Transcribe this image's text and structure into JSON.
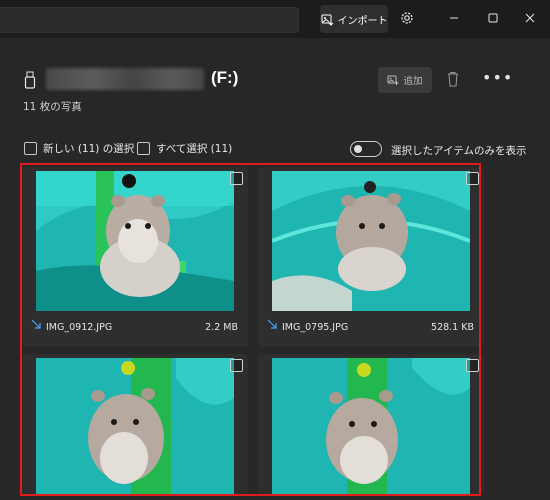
{
  "titlebar": {
    "import_label": "インポート",
    "icons": [
      "import-icon",
      "gear-icon",
      "minimize-icon",
      "maximize-icon",
      "close-icon"
    ]
  },
  "header": {
    "drive_letter": "(F:)",
    "photo_count": "11 枚の写真",
    "add_label": "追加",
    "icons": [
      "usb-drive-icon",
      "add-photo-icon",
      "trash-icon",
      "more-icon"
    ]
  },
  "selection": {
    "select_new_label": "新しい (11) の選択",
    "select_all_label": "すべて選択 (11)",
    "show_selected_label": "選択したアイテムのみを表示",
    "show_selected_on": false
  },
  "photos": [
    {
      "filename": "IMG_0912.JPG",
      "size": "2.2 MB",
      "checked": false
    },
    {
      "filename": "IMG_0795.JPG",
      "size": "528.1 KB",
      "checked": false
    },
    {
      "filename": "",
      "size": "",
      "checked": false
    },
    {
      "filename": "",
      "size": "",
      "checked": false
    }
  ],
  "colors": {
    "background": "#202020",
    "panel": "#272727",
    "card": "#2e2e2e",
    "highlight_border": "#e21c1c",
    "photo_teal": "#1fb5b0"
  }
}
